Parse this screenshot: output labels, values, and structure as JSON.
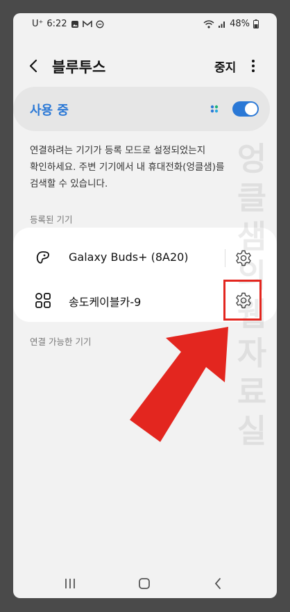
{
  "status_bar": {
    "carrier": "U⁺",
    "time": "6:22",
    "battery": "48%"
  },
  "app_bar": {
    "title": "블루투스",
    "stop_label": "중지"
  },
  "master_switch": {
    "label": "사용 중",
    "state": "on",
    "accent_color": "#2a78d6"
  },
  "description": "연결하려는 기기가 등록 모드로 설정되었는지\n확인하세요. 주변 기기에서 내 휴대전화(엉클샘)를\n검색할 수 있습니다.",
  "sections": {
    "registered_label": "등록된 기기",
    "available_label": "연결 가능한 기기"
  },
  "devices": [
    {
      "name": "Galaxy Buds+ (8A20)",
      "icon": "earbuds-icon"
    },
    {
      "name": "송도케이블카-9",
      "icon": "grid-device-icon"
    }
  ],
  "watermark": "엉클샘의 웹 자료실",
  "highlight_color": "#e3261f"
}
